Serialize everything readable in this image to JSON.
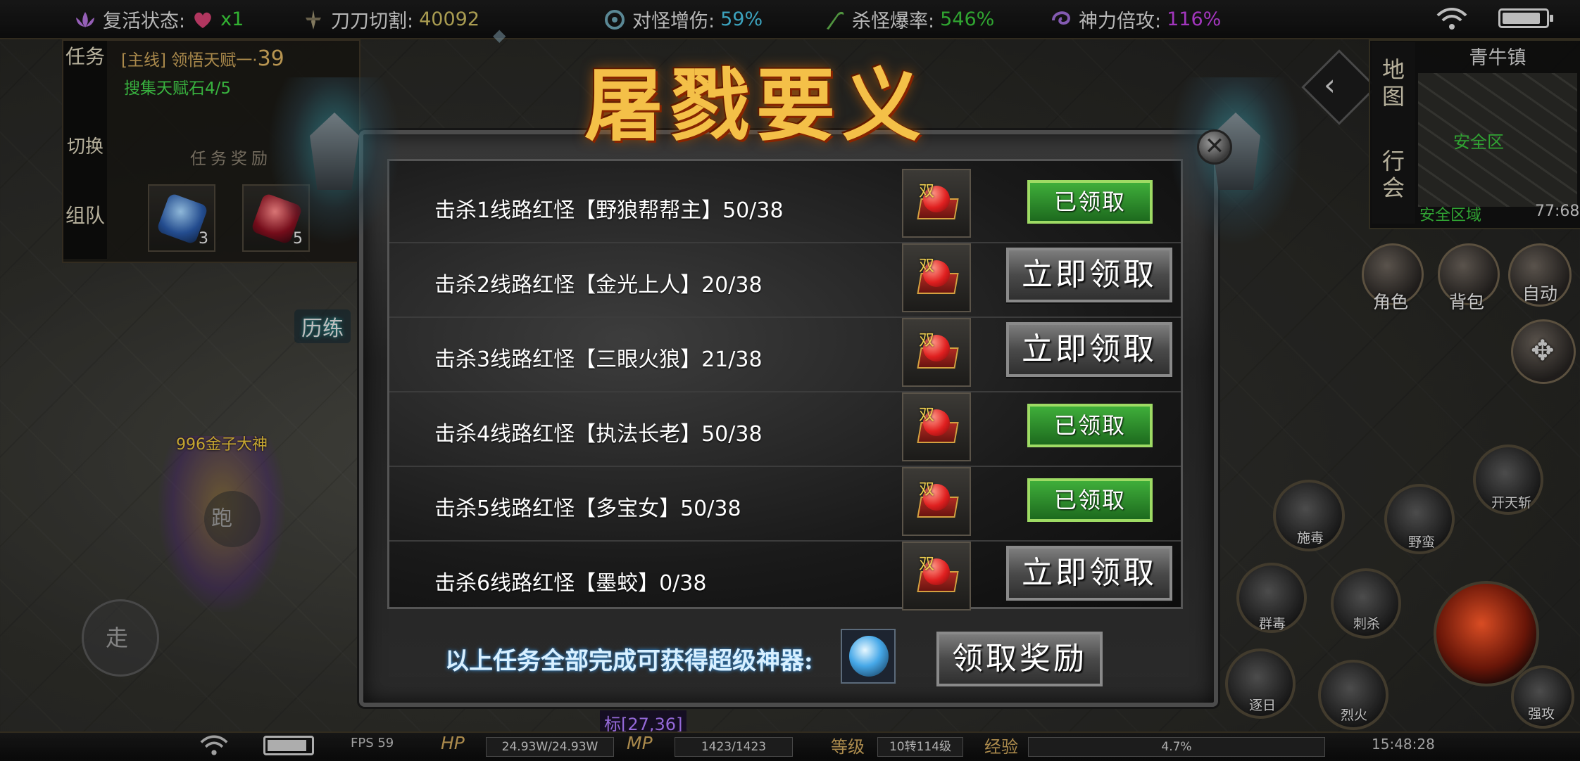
{
  "status_bar": {
    "revive_label": "复活状态:",
    "revive_value": "x1",
    "slash_label": "刀刀切割:",
    "slash_value": "40092",
    "monster_dmg_label": "对怪增伤:",
    "monster_dmg_value": "59%",
    "drop_rate_label": "杀怪爆率:",
    "drop_rate_value": "546%",
    "divine_label": "神力倍攻:",
    "divine_value": "116%",
    "colors": {
      "slash": "#c7b860",
      "monster_dmg": "#47c0e0",
      "drop_rate": "#39c23a",
      "divine": "#c040e0"
    }
  },
  "quest_panel": {
    "tabs": [
      "任务",
      "切换",
      "组队"
    ],
    "main_quest_prefix": "[主线] 领悟天赋一·",
    "main_quest_level": "39",
    "sub_quest": "搜集天赋石4/5",
    "reward_title": "任务奖励",
    "rewards": [
      {
        "icon": "blue-scroll-icon",
        "count": "3"
      },
      {
        "icon": "red-gem-icon",
        "count": "5"
      }
    ],
    "trial_label": "历练"
  },
  "minimap": {
    "tabs": [
      "地图",
      "行会"
    ],
    "town_name": "青牛镇",
    "safe_zone_marker": "安全区",
    "zone_status": "安全区域",
    "coords": "77:68"
  },
  "right_buttons": [
    {
      "label": "角色",
      "icon": "character-icon"
    },
    {
      "label": "背包",
      "icon": "bag-icon"
    },
    {
      "label": "自动",
      "icon": "auto-sword-icon"
    }
  ],
  "skills": [
    {
      "label": "开天斩"
    },
    {
      "label": "施毒"
    },
    {
      "label": "野蛮"
    },
    {
      "label": "群毒"
    },
    {
      "label": "刺杀"
    },
    {
      "label": "烈火"
    },
    {
      "label": "逐日"
    },
    {
      "label": "强攻"
    }
  ],
  "player": {
    "name": "996金子大神",
    "walk_label": "走",
    "run_label": "跑",
    "coord_tag": "标[27,36]"
  },
  "modal": {
    "title": "屠戮要义",
    "double_mark": "双",
    "tasks": [
      {
        "label": "击杀1线路红怪【野狼帮帮主】50/38",
        "state": "claimed",
        "button": "已领取"
      },
      {
        "label": "击杀2线路红怪【金光上人】20/38",
        "state": "available",
        "button": "立即领取"
      },
      {
        "label": "击杀3线路红怪【三眼火狼】21/38",
        "state": "available",
        "button": "立即领取"
      },
      {
        "label": "击杀4线路红怪【执法长老】50/38",
        "state": "claimed",
        "button": "已领取"
      },
      {
        "label": "击杀5线路红怪【多宝女】50/38",
        "state": "claimed",
        "button": "已领取"
      },
      {
        "label": "击杀6线路红怪【墨蛟】0/38",
        "state": "available",
        "button": "立即领取"
      }
    ],
    "final_text": "以上任务全部完成可获得超级神器:",
    "final_button": "领取奖励"
  },
  "bottom_bar": {
    "fps": "FPS 59",
    "hp_label": "HP",
    "hp_value": "24.93W/24.93W",
    "mp_label": "MP",
    "mp_value": "1423/1423",
    "level_label": "等级",
    "level_value": "10转114级",
    "exp_label": "经验",
    "exp_value": "4.7%",
    "time": "15:48:28"
  }
}
